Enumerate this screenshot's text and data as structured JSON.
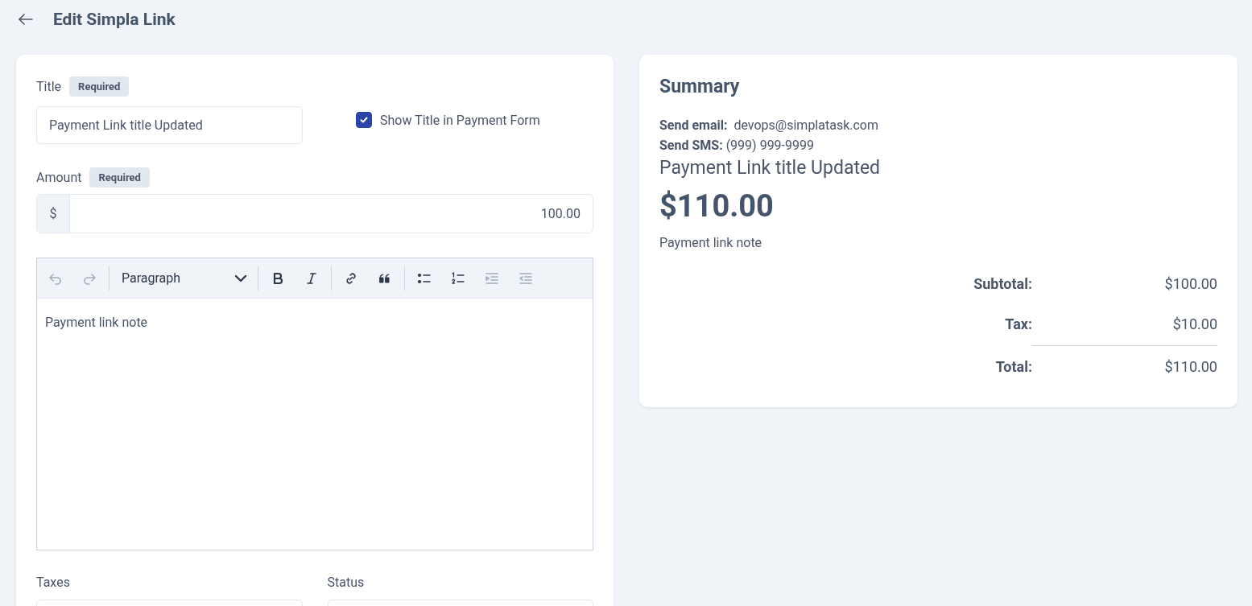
{
  "header": {
    "title": "Edit Simpla Link"
  },
  "form": {
    "title_field": {
      "label": "Title",
      "badge": "Required",
      "value": "Payment Link title Updated"
    },
    "show_title": {
      "label": "Show Title in Payment Form",
      "checked": true
    },
    "amount_field": {
      "label": "Amount",
      "badge": "Required",
      "prefix": "$",
      "value": "100.00"
    },
    "editor": {
      "block_format": "Paragraph",
      "toolbar_groups": [
        [
          {
            "kind": "undo",
            "disabled": true
          },
          {
            "kind": "redo",
            "disabled": true
          }
        ],
        [
          {
            "kind": "format"
          }
        ],
        [
          {
            "kind": "bold",
            "disabled": false
          },
          {
            "kind": "italic",
            "disabled": false
          }
        ],
        [
          {
            "kind": "link",
            "disabled": false
          },
          {
            "kind": "quote",
            "disabled": false
          }
        ],
        [
          {
            "kind": "bullets",
            "disabled": false
          },
          {
            "kind": "numbers",
            "disabled": false
          },
          {
            "kind": "indent",
            "disabled": true
          },
          {
            "kind": "outdent",
            "disabled": true
          }
        ]
      ],
      "content": "Payment link note"
    },
    "taxes_label": "Taxes",
    "status_label": "Status"
  },
  "summary": {
    "title": "Summary",
    "send_email": {
      "label": "Send email:",
      "value": "devops@simplatask.com"
    },
    "send_sms": {
      "label": "Send SMS:",
      "value": "(999) 999-9999"
    },
    "link_title": "Payment Link title Updated",
    "amount": "$110.00",
    "note": "Payment link note",
    "totals": [
      {
        "label": "Subtotal:",
        "value": "$100.00"
      },
      {
        "label": "Tax:",
        "value": "$10.00"
      },
      {
        "label": "Total:",
        "value": "$110.00"
      }
    ]
  }
}
